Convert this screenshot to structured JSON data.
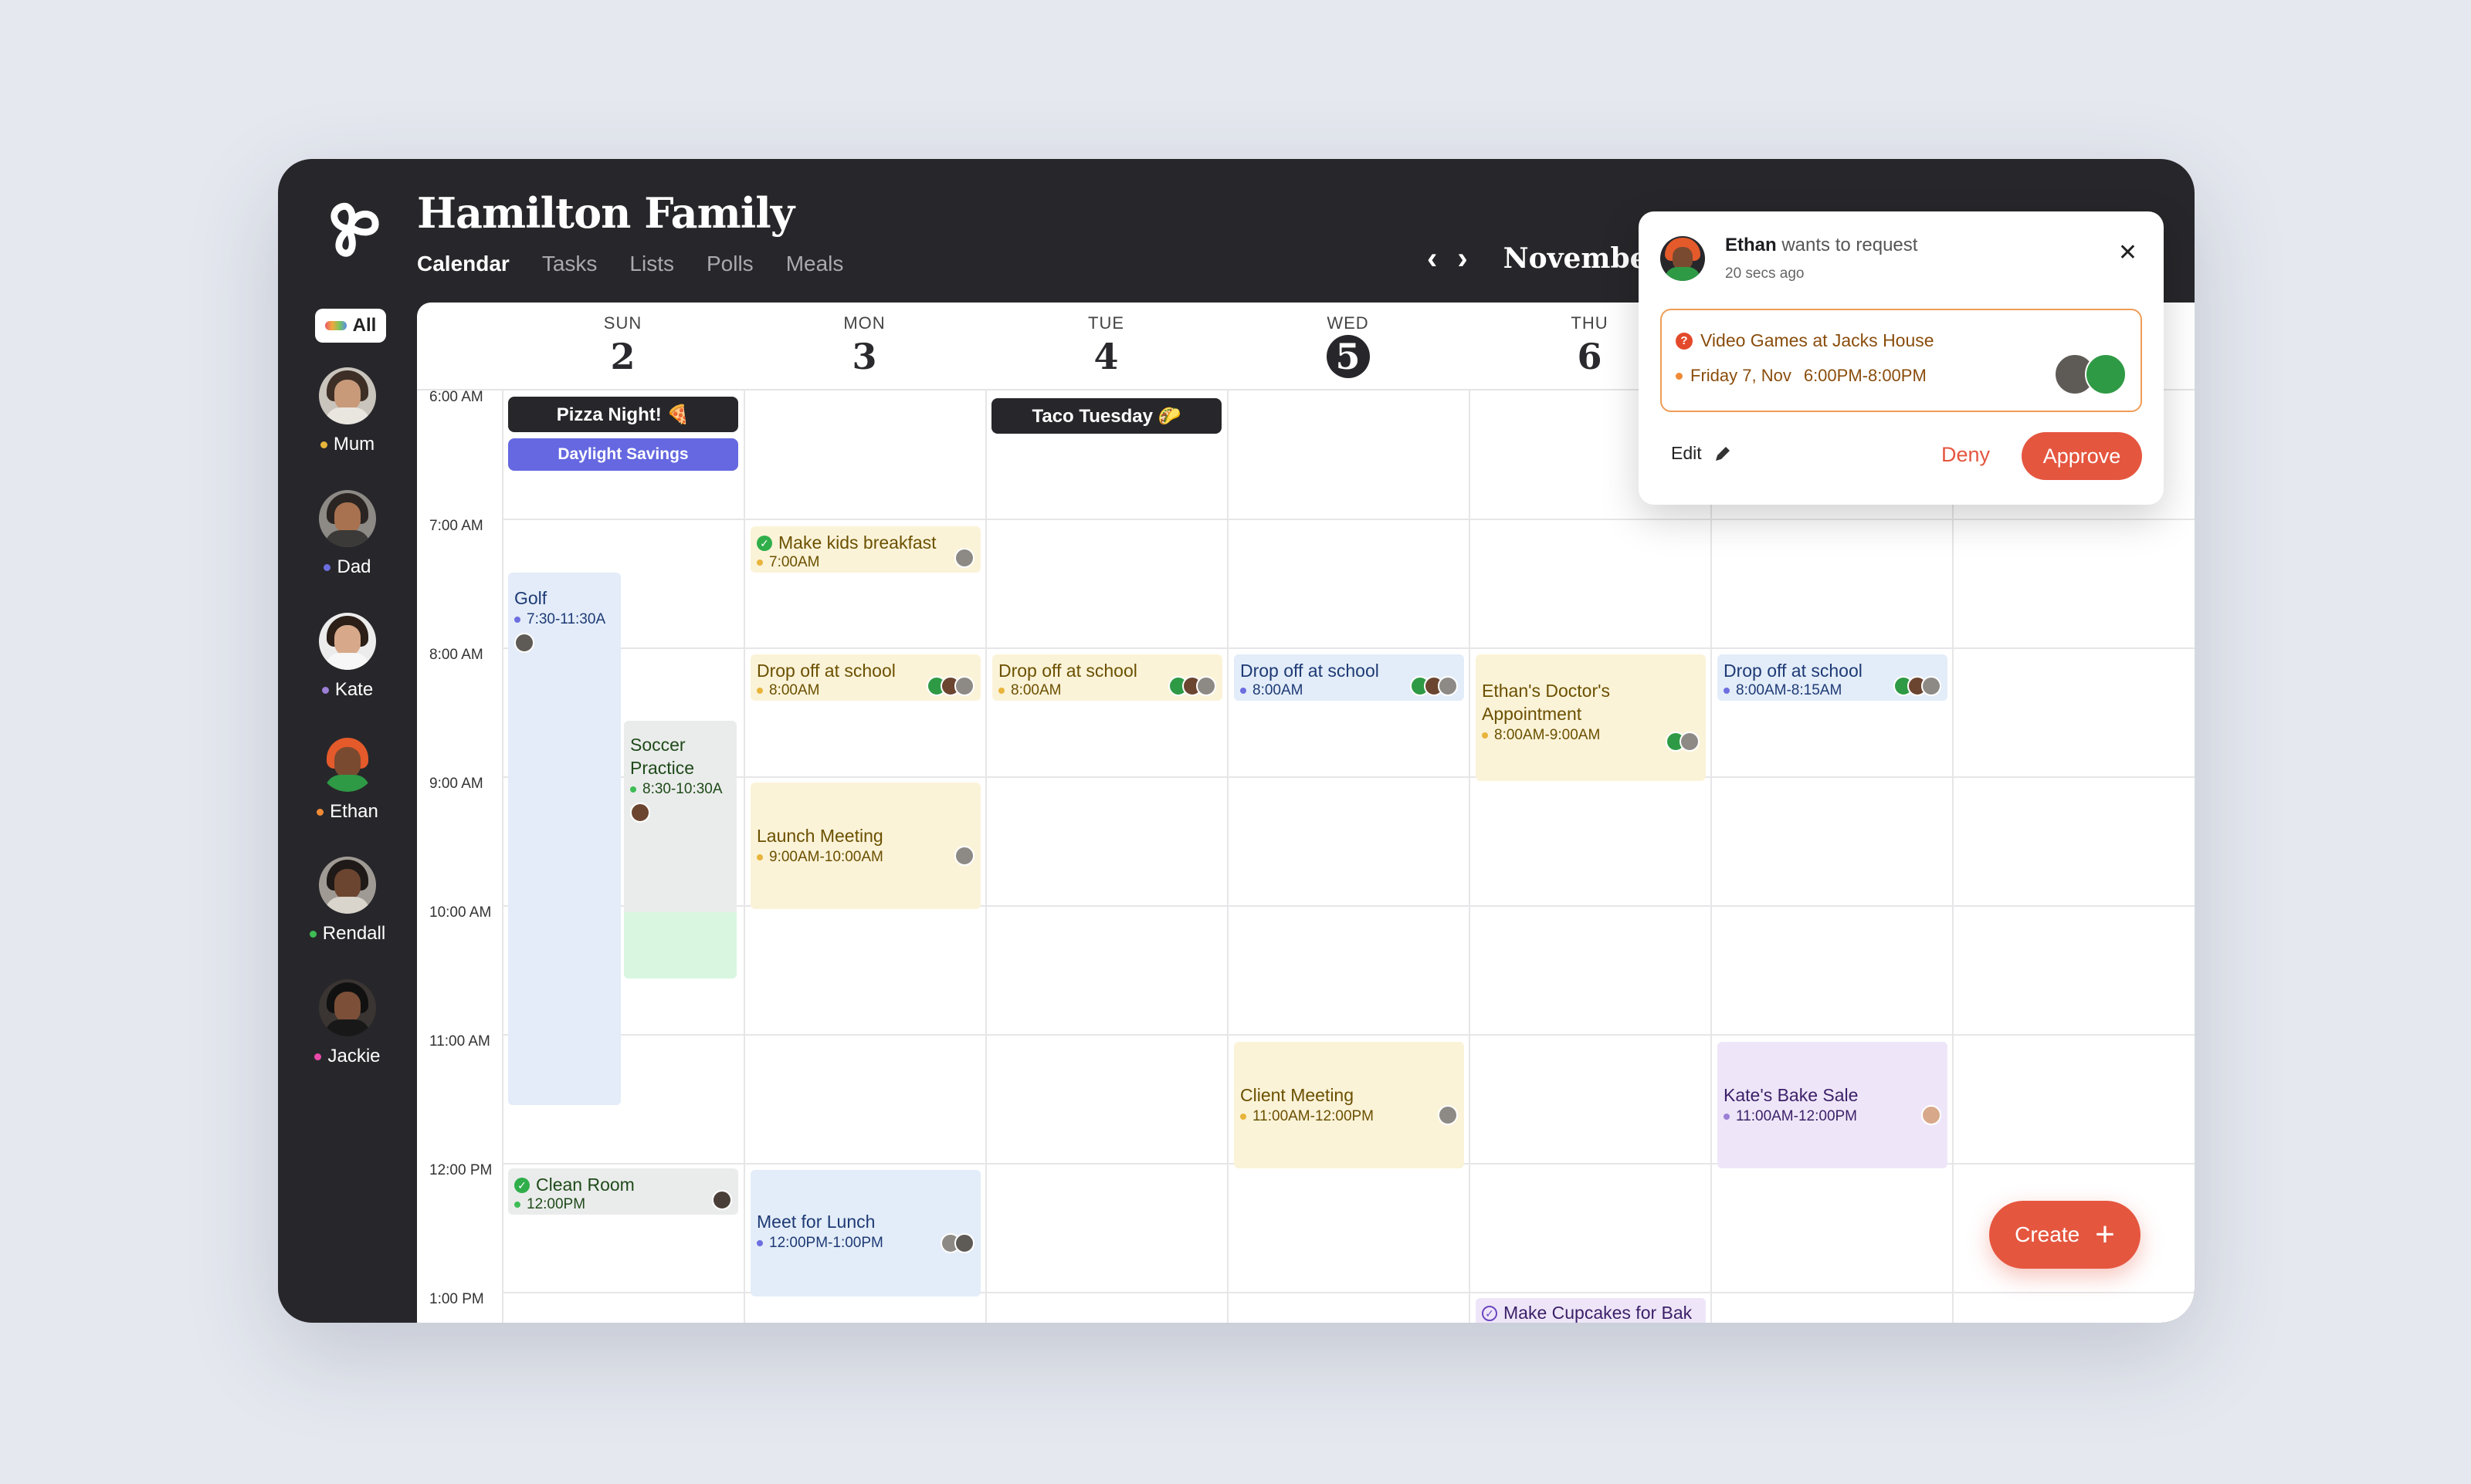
{
  "header": {
    "title": "Hamilton Family",
    "nav": [
      "Calendar",
      "Tasks",
      "Lists",
      "Polls",
      "Meals"
    ],
    "month": "November"
  },
  "sidebar": {
    "all_label": "All",
    "members": [
      {
        "name": "Mum",
        "color": "#e8b43b"
      },
      {
        "name": "Dad",
        "color": "#6d6ee0"
      },
      {
        "name": "Kate",
        "color": "#9c7fd6"
      },
      {
        "name": "Ethan",
        "color": "#f08a36"
      },
      {
        "name": "Rendall",
        "color": "#3ebc55"
      },
      {
        "name": "Jackie",
        "color": "#e94aa8"
      }
    ]
  },
  "calendar": {
    "days": [
      {
        "name": "SUN",
        "num": "2"
      },
      {
        "name": "MON",
        "num": "3"
      },
      {
        "name": "TUE",
        "num": "4"
      },
      {
        "name": "WED",
        "num": "5"
      },
      {
        "name": "THU",
        "num": "6"
      }
    ],
    "times": [
      "6:00 AM",
      "7:00 AM",
      "8:00 AM",
      "9:00 AM",
      "10:00 AM",
      "11:00 AM",
      "12:00 PM",
      "1:00 PM"
    ],
    "chips": {
      "pizza": "Pizza Night! 🍕",
      "daylight": "Daylight Savings",
      "taco": "Taco Tuesday 🌮"
    },
    "events": {
      "golf": {
        "title": "Golf",
        "time": "7:30-11:30A"
      },
      "soccer": {
        "title": "Soccer Practice",
        "time": "8:30-10:30A"
      },
      "clean": {
        "title": "Clean Room",
        "time": "12:00PM"
      },
      "breakfast": {
        "title": "Make kids breakfast",
        "time": "7:00AM"
      },
      "drop_mon": {
        "title": "Drop off at school",
        "time": "8:00AM"
      },
      "launch": {
        "title": "Launch Meeting",
        "time": "9:00AM-10:00AM"
      },
      "lunch": {
        "title": "Meet for Lunch",
        "time": "12:00PM-1:00PM"
      },
      "drop_tue": {
        "title": "Drop off at school",
        "time": "8:00AM"
      },
      "drop_wed": {
        "title": "Drop off at school",
        "time": "8:00AM"
      },
      "client": {
        "title": "Client Meeting",
        "time": "11:00AM-12:00PM"
      },
      "doctor": {
        "title": "Ethan's Doctor's Appointment",
        "time": "8:00AM-9:00AM"
      },
      "cupcakes": {
        "title": "Make Cupcakes for Bak"
      },
      "drop_fri": {
        "title": "Drop off at school",
        "time": "8:00AM-8:15AM"
      },
      "bake": {
        "title": "Kate's Bake Sale",
        "time": "11:00AM-12:00PM"
      }
    }
  },
  "popup": {
    "requester": "Ethan",
    "action": "wants to request",
    "ago": "20 secs ago",
    "event_title": "Video Games at Jacks House",
    "event_date": "Friday 7, Nov",
    "event_time": "6:00PM-8:00PM",
    "edit": "Edit",
    "deny": "Deny",
    "approve": "Approve"
  },
  "create_label": "Create"
}
